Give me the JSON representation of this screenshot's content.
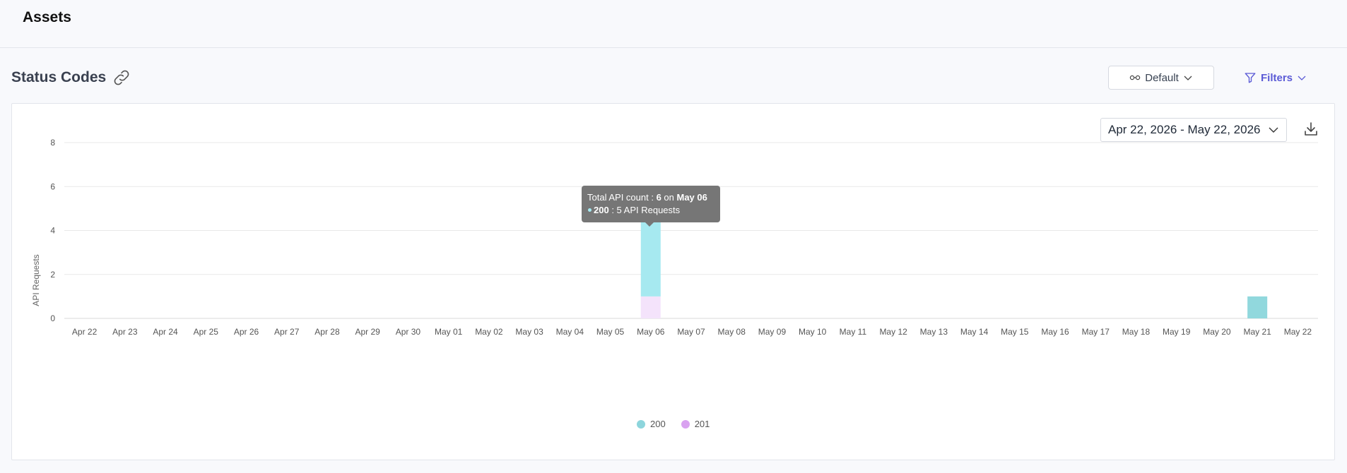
{
  "page": {
    "title": "Assets"
  },
  "section": {
    "title": "Status Codes",
    "view_label": "Default",
    "filters_label": "Filters"
  },
  "date_range": {
    "label": "Apr 22, 2026 - May 22, 2026"
  },
  "tooltip": {
    "prefix": "Total API count : ",
    "total": "6",
    "on": " on ",
    "date": "May 06",
    "code": "200",
    "detail": " : 5 API Requests"
  },
  "colors": {
    "series_200": "#a6e9f0",
    "series_200_legend": "#8dd5dc",
    "series_201": "#f4e3fb",
    "series_201_legend": "#d9a2f0",
    "may21_bar": "#91d8dd",
    "accent": "#5b5bd6"
  },
  "chart_data": {
    "type": "bar",
    "stacked": true,
    "ylabel": "API Requests",
    "xlabel": "",
    "ylim": [
      0,
      8
    ],
    "yticks": [
      0,
      2,
      4,
      6,
      8
    ],
    "grid": true,
    "legend_position": "bottom",
    "categories": [
      "Apr 22",
      "Apr 23",
      "Apr 24",
      "Apr 25",
      "Apr 26",
      "Apr 27",
      "Apr 28",
      "Apr 29",
      "Apr 30",
      "May 01",
      "May 02",
      "May 03",
      "May 04",
      "May 05",
      "May 06",
      "May 07",
      "May 08",
      "May 09",
      "May 10",
      "May 11",
      "May 12",
      "May 13",
      "May 14",
      "May 15",
      "May 16",
      "May 17",
      "May 18",
      "May 19",
      "May 20",
      "May 21",
      "May 22"
    ],
    "series": [
      {
        "name": "200",
        "values": [
          0,
          0,
          0,
          0,
          0,
          0,
          0,
          0,
          0,
          0,
          0,
          0,
          0,
          0,
          5,
          0,
          0,
          0,
          0,
          0,
          0,
          0,
          0,
          0,
          0,
          0,
          0,
          0,
          0,
          1,
          0
        ]
      },
      {
        "name": "201",
        "values": [
          0,
          0,
          0,
          0,
          0,
          0,
          0,
          0,
          0,
          0,
          0,
          0,
          0,
          0,
          1,
          0,
          0,
          0,
          0,
          0,
          0,
          0,
          0,
          0,
          0,
          0,
          0,
          0,
          0,
          0,
          0
        ]
      }
    ]
  }
}
